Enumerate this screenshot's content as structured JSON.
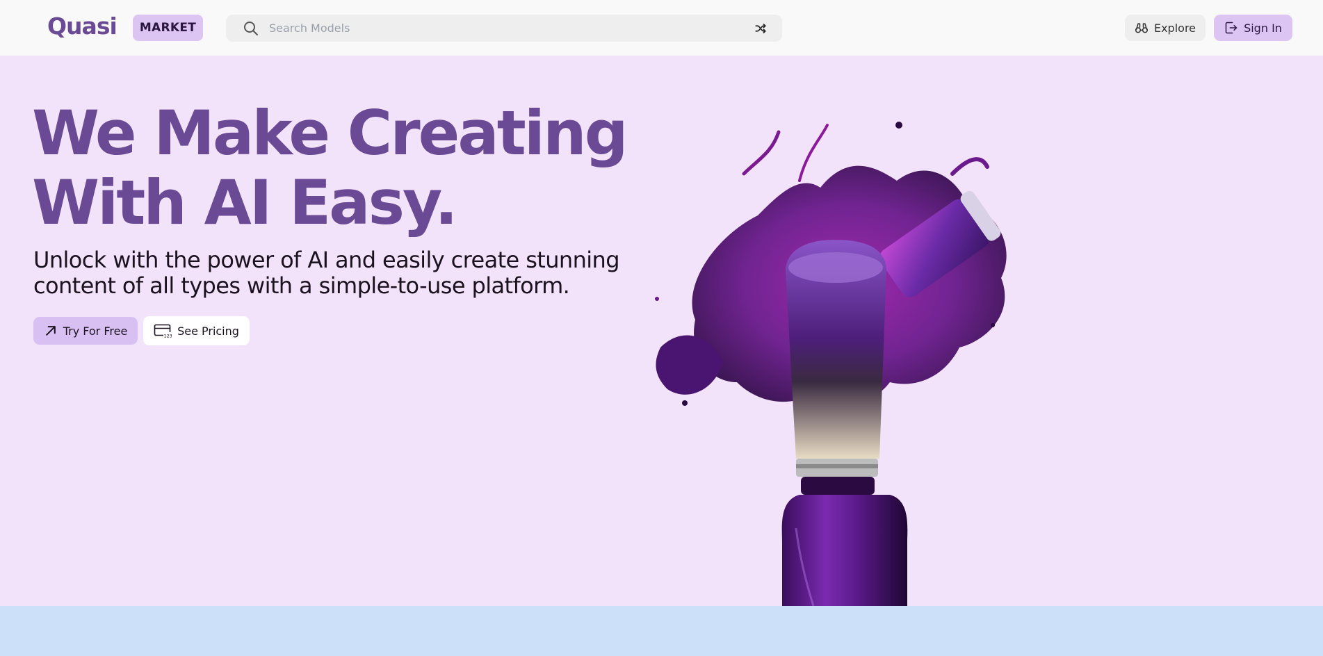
{
  "header": {
    "logo": "Quasi",
    "market_badge": "MARKET",
    "search": {
      "placeholder": "Search Models",
      "value": ""
    },
    "explore_label": "Explore",
    "signin_label": "Sign In"
  },
  "hero": {
    "title_line1": "We Make Creating",
    "title_line2": "With AI Easy.",
    "subtitle_line1": "Unlock with the power of AI and easily create stunning",
    "subtitle_line2": "content of all types with a simple-to-use platform.",
    "try_label": "Try For Free",
    "pricing_label": "See Pricing"
  },
  "icons": {
    "search": "search-icon",
    "shuffle": "shuffle-icon",
    "explore": "binoculars-icon",
    "signin": "sign-in-icon",
    "try": "arrow-up-right-icon",
    "pricing": "credit-card-icon"
  },
  "colors": {
    "brand_purple": "#6a4a95",
    "accent_lavender": "#dcc5f2",
    "hero_background": "#f3e3fa",
    "header_background": "#f9f9f9",
    "bottom_band": "#cce0fa"
  }
}
